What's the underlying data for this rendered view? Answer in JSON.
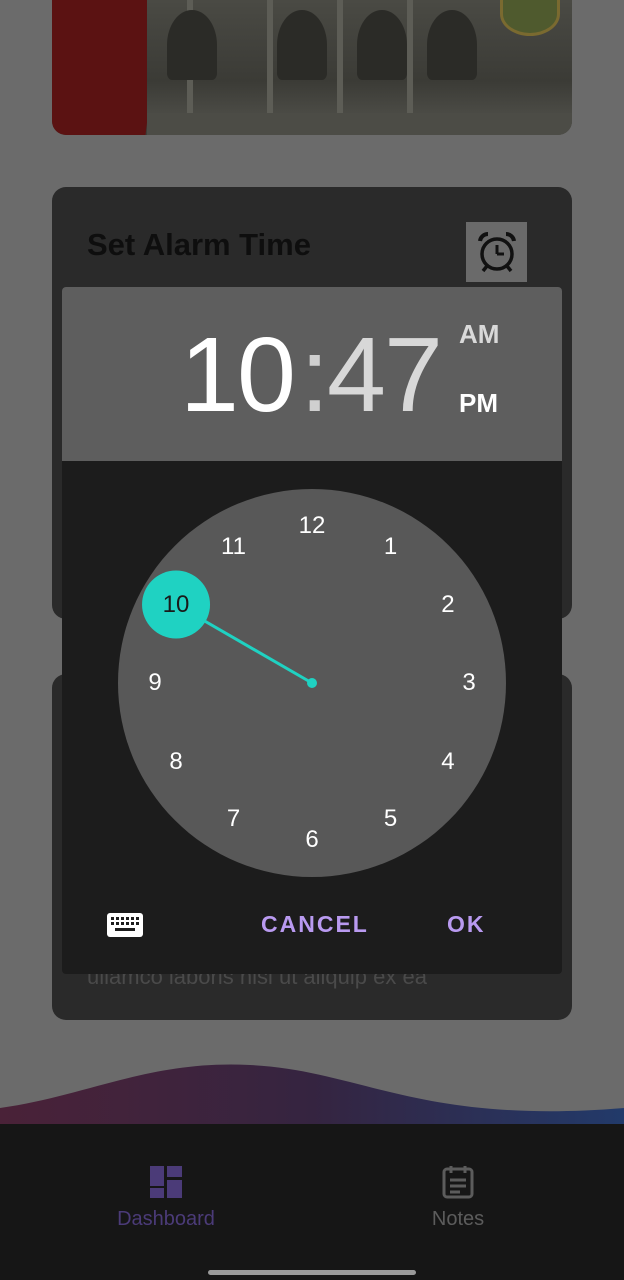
{
  "alarm_card": {
    "title": "Set Alarm Time",
    "icon": "alarm-clock-icon"
  },
  "notes_card": {
    "visible_text": "ullamco laboris nisi ut aliquip ex ea"
  },
  "time_picker": {
    "hour": "10",
    "separator": ":",
    "minute": "47",
    "am_label": "AM",
    "pm_label": "PM",
    "selected_period": "PM",
    "mode": "hour",
    "selected_hour": 10,
    "clock_numbers": [
      "12",
      "1",
      "2",
      "3",
      "4",
      "5",
      "6",
      "7",
      "8",
      "9",
      "10",
      "11"
    ],
    "keyboard_icon": "keyboard-icon",
    "cancel_label": "CANCEL",
    "ok_label": "OK",
    "colors": {
      "accent": "#1fd2c2",
      "button_text": "#b99af0",
      "header_bg": "#5e5e5e",
      "clock_bg": "#585858"
    }
  },
  "bottom_nav": {
    "items": [
      {
        "label": "Dashboard",
        "icon": "dashboard-icon",
        "active": true
      },
      {
        "label": "Notes",
        "icon": "notes-icon",
        "active": false
      }
    ]
  }
}
